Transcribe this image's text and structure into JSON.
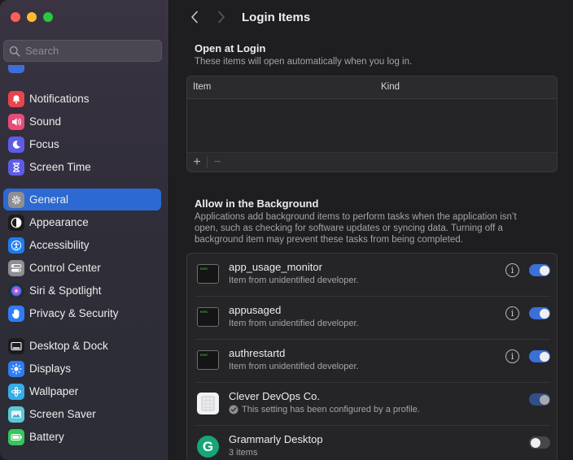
{
  "sidebar": {
    "search_placeholder": "Search",
    "items": [
      {
        "label": "Notifications",
        "icon": "bell-icon",
        "color": "#e8444d"
      },
      {
        "label": "Sound",
        "icon": "speaker-icon",
        "color": "#e94b78"
      },
      {
        "label": "Focus",
        "icon": "moon-icon",
        "color": "#5e5ce6"
      },
      {
        "label": "Screen Time",
        "icon": "hourglass-icon",
        "color": "#5e5ce6"
      },
      {
        "label": "General",
        "icon": "gear-icon",
        "color": "#8e8e93",
        "active": true
      },
      {
        "label": "Appearance",
        "icon": "appearance-icon",
        "color": "#1c1c1e"
      },
      {
        "label": "Accessibility",
        "icon": "accessibility-icon",
        "color": "#1f7cf0"
      },
      {
        "label": "Control Center",
        "icon": "control-center-icon",
        "color": "#8e8e93"
      },
      {
        "label": "Siri & Spotlight",
        "icon": "siri-icon",
        "color": "#2a2a2e"
      },
      {
        "label": "Privacy & Security",
        "icon": "hand-icon",
        "color": "#2f7cf5"
      },
      {
        "label": "Desktop & Dock",
        "icon": "dock-icon",
        "color": "#1c1c1e"
      },
      {
        "label": "Displays",
        "icon": "sun-icon",
        "color": "#2f7cf5"
      },
      {
        "label": "Wallpaper",
        "icon": "wallpaper-icon",
        "color": "#35aee8"
      },
      {
        "label": "Screen Saver",
        "icon": "screen-saver-icon",
        "color": "#5ac8d8"
      },
      {
        "label": "Battery",
        "icon": "battery-icon",
        "color": "#34c759"
      }
    ]
  },
  "header": {
    "title": "Login Items"
  },
  "open_at_login": {
    "title": "Open at Login",
    "subtitle": "These items will open automatically when you log in.",
    "col_item": "Item",
    "col_kind": "Kind",
    "add_label": "+",
    "remove_label": "−"
  },
  "background": {
    "title": "Allow in the Background",
    "subtitle": "Applications add background items to perform tasks when the application isn’t open, such as checking for software updates or syncing data. Turning off a background item may prevent these tasks from being completed.",
    "items": [
      {
        "name": "app_usage_monitor",
        "sub": "Item from unidentified developer.",
        "icon": "terminal-icon",
        "term_text": "exec",
        "enabled": true
      },
      {
        "name": "appusaged",
        "sub": "Item from unidentified developer.",
        "icon": "terminal-icon",
        "term_text": "exec",
        "enabled": true
      },
      {
        "name": "authrestartd",
        "sub": "Item from unidentified developer.",
        "icon": "terminal-icon",
        "term_text": "exec",
        "enabled": true
      },
      {
        "name": "Clever DevOps Co.",
        "sub": "This setting has been configured by a profile.",
        "icon": "document-icon",
        "enabled": true,
        "managed": true
      },
      {
        "name": "Grammarly Desktop",
        "sub": "3 items",
        "icon": "grammarly-icon",
        "badge_letter": "G",
        "enabled": false
      }
    ]
  }
}
